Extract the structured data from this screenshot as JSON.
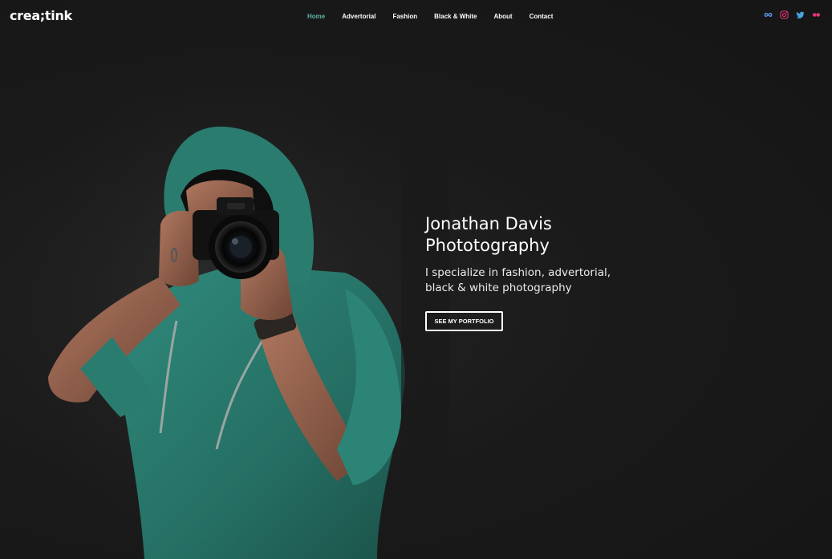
{
  "brand": {
    "logo": "crea;tink"
  },
  "nav": {
    "items": [
      {
        "label": "Home",
        "active": true
      },
      {
        "label": "Advertorial",
        "active": false
      },
      {
        "label": "Fashion",
        "active": false
      },
      {
        "label": "Black & White",
        "active": false
      },
      {
        "label": "About",
        "active": false
      },
      {
        "label": "Contact",
        "active": false
      }
    ]
  },
  "social": [
    {
      "icon": "flickr-infinity-icon",
      "color": "#5b8fd6"
    },
    {
      "icon": "instagram-icon",
      "color": "#d6336c"
    },
    {
      "icon": "twitter-icon",
      "color": "#4aa3e0"
    },
    {
      "icon": "flickr-icon",
      "color": "#e0357a"
    }
  ],
  "hero": {
    "title_line1": "Jonathan Davis",
    "title_line2": "Phototography",
    "subtitle_line1": "I specialize in fashion, advertorial,",
    "subtitle_line2": "black & white photography",
    "cta_label": "SEE MY PORTFOLIO"
  },
  "colors": {
    "accent": "#5fb3a6",
    "background": "#161616",
    "hoodie": "#2b7a6e"
  }
}
